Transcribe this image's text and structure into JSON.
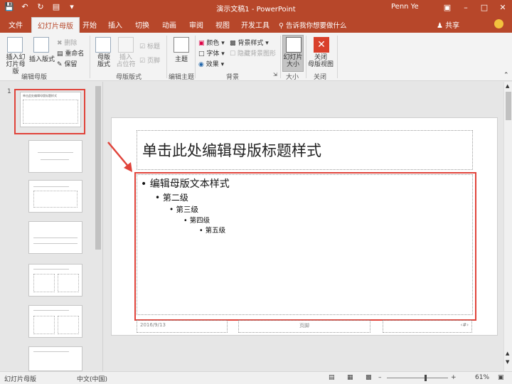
{
  "titlebar": {
    "doc_title": "演示文稿1 - PowerPoint",
    "user": "Penn Ye",
    "qat_icons": [
      "save-icon",
      "undo-icon",
      "redo-icon",
      "start-from-beginning-icon",
      "customize-qat-icon"
    ]
  },
  "tabs": {
    "file": "文件",
    "slide_master": "幻灯片母版",
    "home": "开始",
    "insert": "插入",
    "transitions": "切换",
    "animations": "动画",
    "review": "审阅",
    "view": "视图",
    "developer": "开发工具",
    "tell_me": "告诉我你想要做什么",
    "share": "共享"
  },
  "ribbon": {
    "edit_master": {
      "insert_slide_master": "插入幻\n灯片母版",
      "insert_layout": "插入版式",
      "delete": "删除",
      "rename": "重命名",
      "preserve": "保留",
      "label": "编辑母版"
    },
    "master_layout": {
      "master_layout": "母版\n版式",
      "insert_placeholder": "插入\n占位符",
      "title": "标题",
      "footers": "页脚",
      "label": "母版版式"
    },
    "edit_theme": {
      "themes": "主题",
      "label": "编辑主题"
    },
    "background": {
      "colors": "颜色",
      "fonts": "字体",
      "effects": "效果",
      "background_styles": "背景样式",
      "hide_background_graphics": "隐藏背景图形",
      "label": "背景"
    },
    "size": {
      "slide_size": "幻灯片\n大小",
      "label": "大小"
    },
    "close": {
      "close_master_view": "关闭\n母版视图",
      "label": "关闭"
    }
  },
  "thumbnails": {
    "slide_number": "1",
    "master_title": "单击此处编辑母版标题样式"
  },
  "slide": {
    "title": "单击此处编辑母版标题样式",
    "levels": [
      "编辑母版文本样式",
      "第二级",
      "第三级",
      "第四级",
      "第五级"
    ],
    "footer_date": "2016/9/13",
    "footer_text": "页脚",
    "footer_number": "‹#›"
  },
  "statusbar": {
    "view_name": "幻灯片母版",
    "language": "中文(中国)",
    "zoom": "61%"
  },
  "colors": {
    "accent": "#b7472a",
    "highlight_red": "#e0433a"
  }
}
